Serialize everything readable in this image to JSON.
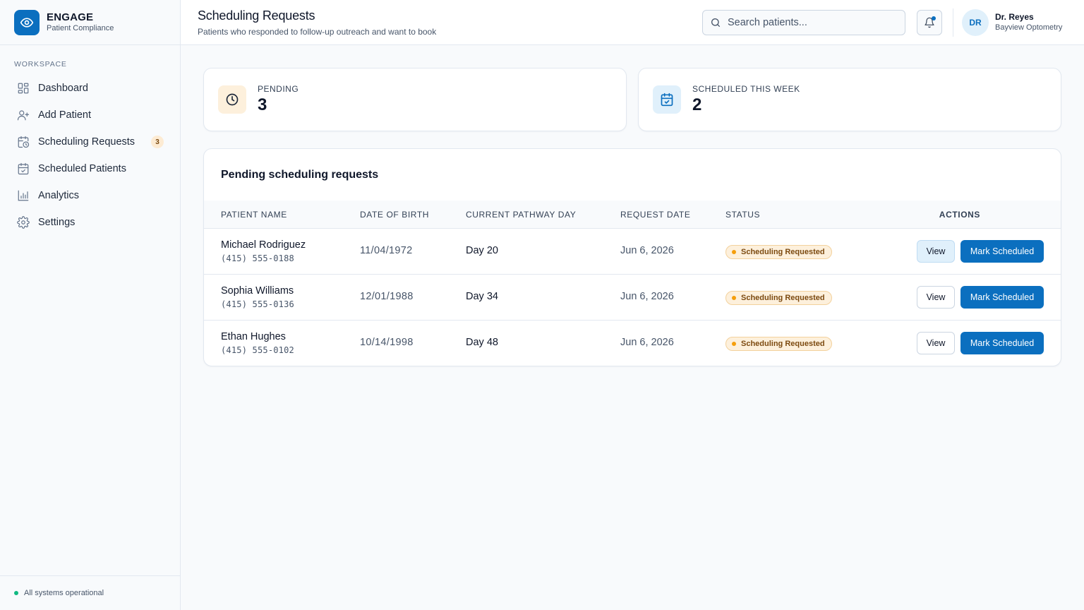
{
  "brand": {
    "name": "ENGAGE",
    "subtitle": "Patient Compliance"
  },
  "sidebar": {
    "section_label": "WORKSPACE",
    "items": [
      {
        "label": "Dashboard",
        "icon": "dashboard-grid-icon"
      },
      {
        "label": "Add Patient",
        "icon": "user-plus-icon"
      },
      {
        "label": "Scheduling Requests",
        "icon": "calendar-clock-icon",
        "badge": "3"
      },
      {
        "label": "Scheduled Patients",
        "icon": "calendar-check-icon"
      },
      {
        "label": "Analytics",
        "icon": "bar-chart-icon"
      },
      {
        "label": "Settings",
        "icon": "gear-icon"
      }
    ],
    "footer_status": "All systems operational"
  },
  "header": {
    "title": "Scheduling Requests",
    "subtitle": "Patients who responded to follow-up outreach and want to book",
    "search_placeholder": "Search patients...",
    "user": {
      "initials": "DR",
      "name": "Dr. Reyes",
      "org": "Bayview Optometry"
    }
  },
  "stats": [
    {
      "label": "PENDING",
      "value": "3",
      "icon": "clock-icon"
    },
    {
      "label": "SCHEDULED THIS WEEK",
      "value": "2",
      "icon": "calendar-check-icon"
    }
  ],
  "table": {
    "title": "Pending scheduling requests",
    "columns": [
      "PATIENT NAME",
      "DATE OF BIRTH",
      "CURRENT PATHWAY DAY",
      "REQUEST DATE",
      "STATUS",
      "ACTIONS"
    ],
    "rows": [
      {
        "name": "Michael Rodriguez",
        "phone": "(415) 555-0188",
        "dob": "11/04/1972",
        "day": "Day 20",
        "request_date": "Jun 6, 2026",
        "status": "Scheduling Requested"
      },
      {
        "name": "Sophia Williams",
        "phone": "(415) 555-0136",
        "dob": "12/01/1988",
        "day": "Day 34",
        "request_date": "Jun 6, 2026",
        "status": "Scheduling Requested"
      },
      {
        "name": "Ethan Hughes",
        "phone": "(415) 555-0102",
        "dob": "10/14/1998",
        "day": "Day 48",
        "request_date": "Jun 6, 2026",
        "status": "Scheduling Requested"
      }
    ],
    "view_label": "View",
    "mark_label": "Mark Scheduled"
  },
  "colors": {
    "primary": "#0b6fbf",
    "status_warning": "#f59e0b",
    "status_ok": "#10b981"
  }
}
